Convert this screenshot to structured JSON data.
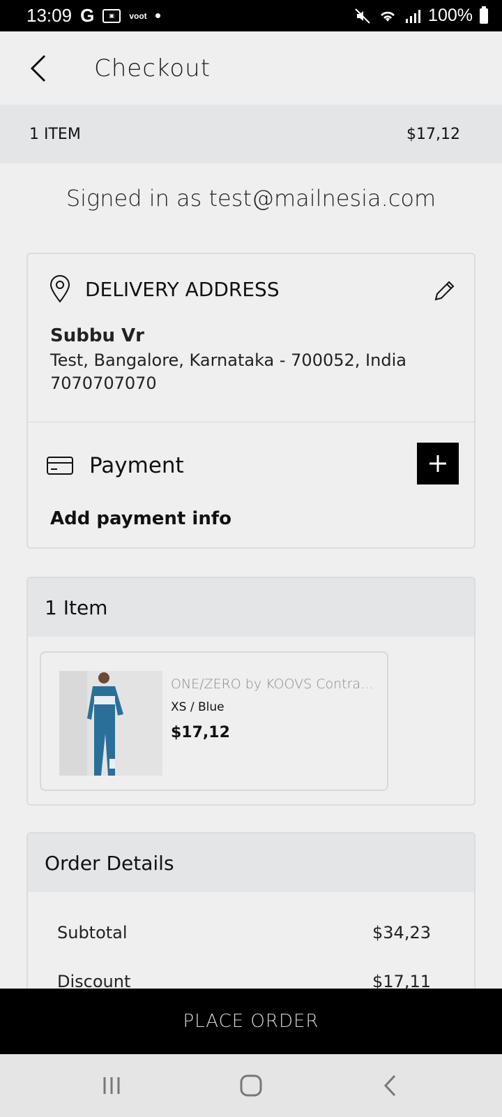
{
  "status_bar": {
    "time": "13:09",
    "g_label": "G",
    "voot_label": "voot",
    "battery": "100%"
  },
  "app_bar": {
    "title": "Checkout"
  },
  "summary": {
    "items_label": "1 ITEM",
    "total": "$17,12"
  },
  "account": {
    "signed_in_text": "Signed in as test@mailnesia.com"
  },
  "delivery": {
    "title": "DELIVERY ADDRESS",
    "name": "Subbu Vr",
    "address_line": "Test, Bangalore, Karnataka - 700052, India",
    "phone": "7070707070"
  },
  "payment": {
    "title": "Payment",
    "info": "Add payment info"
  },
  "items_section": {
    "title": "1 Item",
    "products": [
      {
        "name": "ONE/ZERO by KOOVS Contra...",
        "variant": "XS / Blue",
        "price": "$17,12"
      }
    ]
  },
  "order_details": {
    "title": "Order Details",
    "subtotal_label": "Subtotal",
    "subtotal_value": "$34,23",
    "discount_label": "Discount",
    "discount_value": "$17,11"
  },
  "footer": {
    "place_order_label": "PLACE ORDER"
  },
  "colors": {
    "accent": "#000000",
    "background": "#efefef",
    "section_header": "#e4e5e7"
  }
}
